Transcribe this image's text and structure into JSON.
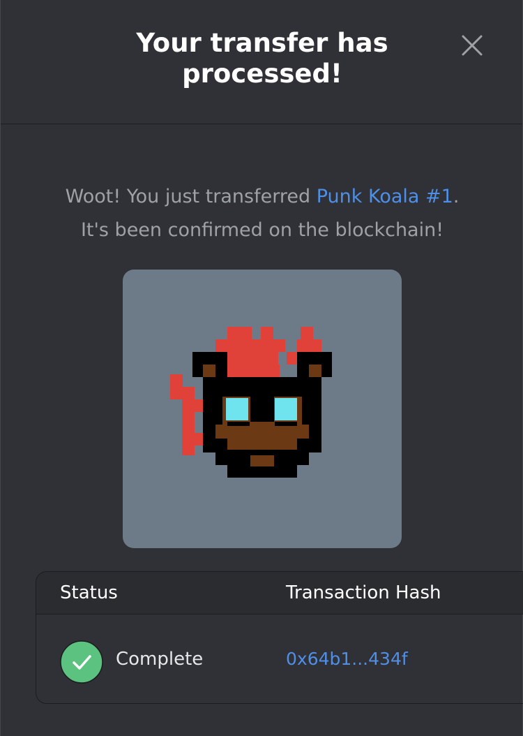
{
  "modal": {
    "title": "Your transfer has processed!",
    "message_prefix": "Woot! You just transferred ",
    "nft_name": "Punk Koala #1",
    "message_suffix": ".",
    "message_line2": "It's been confirmed on the blockchain!",
    "close_icon": "close-icon"
  },
  "nft_image": {
    "background": "#6d7b88",
    "icon": "pixel-koala-avatar"
  },
  "table": {
    "headers": {
      "status": "Status",
      "hash": "Transaction Hash"
    },
    "row": {
      "status": "Complete",
      "status_icon": "check-circle-icon",
      "hash": "0x64b1...434f"
    }
  },
  "colors": {
    "background": "#2f3136",
    "accent_link": "#4f8fe6",
    "success": "#5cc27f",
    "title": "#ffffff",
    "muted_text": "#9ea1a6"
  }
}
